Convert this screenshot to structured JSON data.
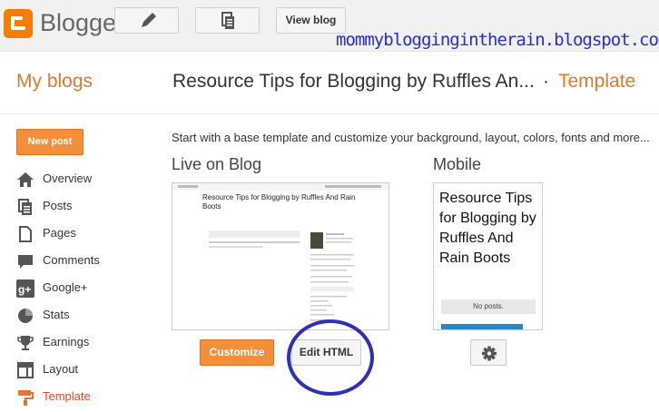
{
  "app": {
    "brand": "Blogger"
  },
  "toolbar": {
    "view_blog": "View blog"
  },
  "watermark": "mommybloggingintherain.blogspot.com",
  "header": {
    "my_blogs": "My blogs",
    "blog_title": "Resource Tips for Blogging by Ruffles An...",
    "separator": "·",
    "section": "Template"
  },
  "sidebar": {
    "new_post": "New post",
    "items": [
      {
        "label": "Overview",
        "icon": "home-icon"
      },
      {
        "label": "Posts",
        "icon": "posts-icon"
      },
      {
        "label": "Pages",
        "icon": "pages-icon"
      },
      {
        "label": "Comments",
        "icon": "comment-icon"
      },
      {
        "label": "Google+",
        "icon": "google-plus-icon"
      },
      {
        "label": "Stats",
        "icon": "pie-chart-icon"
      },
      {
        "label": "Earnings",
        "icon": "trophy-icon"
      },
      {
        "label": "Layout",
        "icon": "layout-icon"
      },
      {
        "label": "Template",
        "icon": "paint-roller-icon"
      }
    ]
  },
  "main": {
    "intro": "Start with a base template and customize your background, layout, colors, fonts and more...",
    "live_heading": "Live on Blog",
    "mobile_heading": "Mobile",
    "preview_title": "Resource Tips for Blogging by Ruffles And Rain Boots",
    "mobile_title": "Resource Tips for Blogging by Ruffles And Rain Boots",
    "mobile_no_posts": "No posts.",
    "customize": "Customize",
    "edit_html": "Edit HTML"
  },
  "colors": {
    "accent": "#f38f3a",
    "brand_orange": "#f57d00",
    "annotation": "#2f2fb8"
  }
}
